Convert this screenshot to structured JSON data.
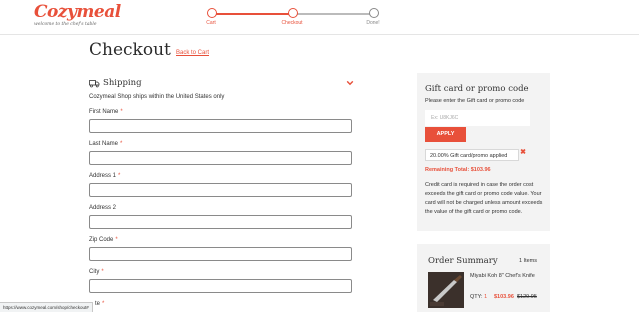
{
  "brand": {
    "name": "Cozymeal",
    "tagline": "welcome to the chef's table"
  },
  "steps": [
    {
      "label": "Cart"
    },
    {
      "label": "Checkout"
    },
    {
      "label": "Done!"
    }
  ],
  "page": {
    "title": "Checkout",
    "back_link": "Back to Cart"
  },
  "shipping": {
    "title": "Shipping",
    "note": "Cozymeal Shop ships within the United States only",
    "fields": [
      {
        "label": "First Name",
        "required": "*"
      },
      {
        "label": "Last Name",
        "required": "*"
      },
      {
        "label": "Address 1",
        "required": "*"
      },
      {
        "label": "Address 2",
        "required": ""
      },
      {
        "label": "Zip Code",
        "required": "*"
      },
      {
        "label": "City",
        "required": "*"
      }
    ],
    "partial_label": "te",
    "partial_required": "*"
  },
  "promo": {
    "title": "Gift card or promo code",
    "subtitle": "Please enter the Gift card or promo code",
    "placeholder": "Ex: U8KJ6C",
    "apply_label": "APPLY",
    "applied_text": "20.00% Gift card/promo applied",
    "remove_icon": "✖",
    "remaining": "Remaining Total: $103.96",
    "note": "Credit card is required in case the order cost exceeds the gift card or promo code value. Your card will not be charged unless amount exceeds the value of the gift card or promo code."
  },
  "summary": {
    "title": "Order Summary",
    "count": "1 Items",
    "item": {
      "name": "Miyabi Koh 8\" Chef's Knife",
      "qty_label": "QTY:",
      "qty": "1",
      "price": "$103.96",
      "old_price": "$129.95"
    }
  },
  "status_url": "https://www.cozymeal.com/shop/checkout#",
  "colors": {
    "accent": "#e8503a",
    "card_bg": "#f3f3f3"
  }
}
